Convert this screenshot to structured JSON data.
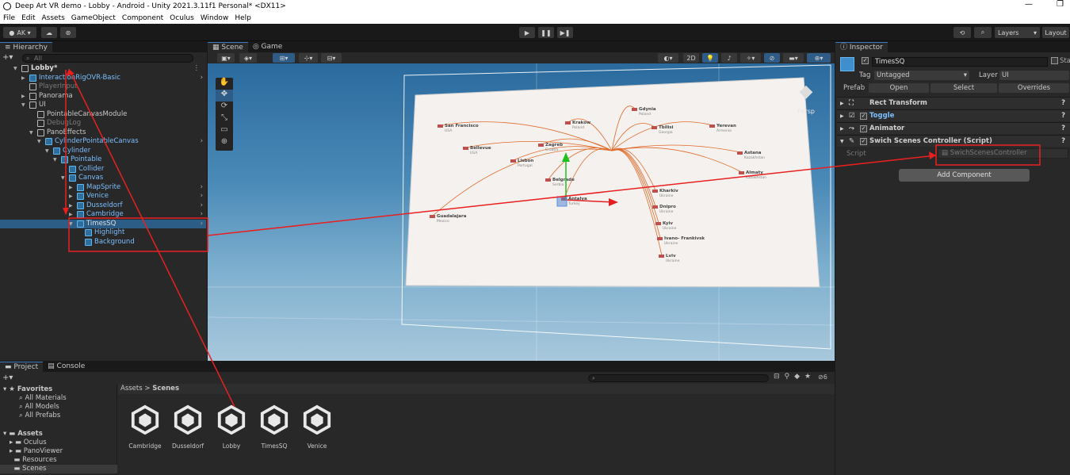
{
  "window": {
    "title": "Deep Art VR demo - Lobby - Android - Unity 2021.3.11f1 Personal* <DX11>",
    "minimize": "—",
    "restore": "❐"
  },
  "menu": [
    "File",
    "Edit",
    "Assets",
    "GameObject",
    "Component",
    "Oculus",
    "Window",
    "Help"
  ],
  "toolbar": {
    "account": "AK ▾",
    "layers": "Layers",
    "layout": "Layout"
  },
  "hierarchy": {
    "tab": "Hierarchy",
    "search_placeholder": "All",
    "rows": [
      {
        "label": "Lobby*",
        "depth": 0,
        "style": "white"
      },
      {
        "label": "InteractionRigOVR-Basic",
        "depth": 1,
        "style": "blue"
      },
      {
        "label": "PlayerInput",
        "depth": 1,
        "style": "dim"
      },
      {
        "label": "Panorama",
        "depth": 1,
        "style": "normal"
      },
      {
        "label": "UI",
        "depth": 1,
        "style": "normal"
      },
      {
        "label": "PointableCanvasModule",
        "depth": 2,
        "style": "normal"
      },
      {
        "label": "DebugLog",
        "depth": 2,
        "style": "dim"
      },
      {
        "label": "PanoEffects",
        "depth": 2,
        "style": "normal"
      },
      {
        "label": "CylinderPointableCanvas",
        "depth": 3,
        "style": "blue"
      },
      {
        "label": "Cylinder",
        "depth": 4,
        "style": "blue"
      },
      {
        "label": "Pointable",
        "depth": 5,
        "style": "blue"
      },
      {
        "label": "Collider",
        "depth": 6,
        "style": "blue"
      },
      {
        "label": "Canvas",
        "depth": 6,
        "style": "blue"
      },
      {
        "label": "MapSprite",
        "depth": 7,
        "style": "blue"
      },
      {
        "label": "Venice",
        "depth": 7,
        "style": "blue"
      },
      {
        "label": "Dusseldorf",
        "depth": 7,
        "style": "blue"
      },
      {
        "label": "Cambridge",
        "depth": 7,
        "style": "blue"
      },
      {
        "label": "TimesSQ",
        "depth": 7,
        "style": "white",
        "selected": true
      },
      {
        "label": "Highlight",
        "depth": 8,
        "style": "blue"
      },
      {
        "label": "Background",
        "depth": 8,
        "style": "blue"
      }
    ]
  },
  "scene": {
    "tab_scene": "Scene",
    "tab_game": "Game",
    "mode_2d": "2D",
    "persp": "Persp"
  },
  "map_labels": [
    {
      "city": "San Francisco",
      "country": "USA"
    },
    {
      "city": "Bellevue",
      "country": "USA"
    },
    {
      "city": "Lisbon",
      "country": "Portugal"
    },
    {
      "city": "Krakow",
      "country": "Poland"
    },
    {
      "city": "Gdynia",
      "country": "Poland"
    },
    {
      "city": "Zagreb",
      "country": "Croatia"
    },
    {
      "city": "Tbilisi",
      "country": "Georgia"
    },
    {
      "city": "Yerevan",
      "country": "Armenia"
    },
    {
      "city": "Astana",
      "country": "Kazakhstan"
    },
    {
      "city": "Almaty",
      "country": "Kazakhstan"
    },
    {
      "city": "Belgrade",
      "country": "Serbia"
    },
    {
      "city": "Antalya",
      "country": "Turkey"
    },
    {
      "city": "Kharkiv",
      "country": "Ukraine"
    },
    {
      "city": "Dnipro",
      "country": "Ukraine"
    },
    {
      "city": "Kyiv",
      "country": "Ukraine"
    },
    {
      "city": "Ivano- Frankivsk",
      "country": "Ukraine"
    },
    {
      "city": "Lviv",
      "country": "Ukraine"
    },
    {
      "city": "Guadalajara",
      "country": "Mexico"
    }
  ],
  "inspector": {
    "tab": "Inspector",
    "object_name": "TimesSQ",
    "static_label": "Sta",
    "tag_label": "Tag",
    "tag_value": "Untagged",
    "layer_label": "Layer",
    "layer_value": "UI",
    "prefab_label": "Prefab",
    "prefab_open": "Open",
    "prefab_select": "Select",
    "prefab_overrides": "Overrides",
    "components": [
      "Rect Transform",
      "Toggle",
      "Animator",
      "Swich Scenes Controller (Script)"
    ],
    "script_label": "Script",
    "script_value": "SwichScenesController",
    "add_component": "Add Component"
  },
  "project": {
    "tab_project": "Project",
    "tab_console": "Console",
    "favorites": "Favorites",
    "favorite_items": [
      "All Materials",
      "All Models",
      "All Prefabs"
    ],
    "assets": "Assets",
    "asset_folders": [
      "Oculus",
      "PanoViewer",
      "Resources",
      "Scenes"
    ],
    "breadcrumb_root": "Assets",
    "breadcrumb_sep": ">",
    "breadcrumb_current": "Scenes",
    "scenes": [
      "Cambridge",
      "Dusseldorf",
      "Lobby",
      "TimesSQ",
      "Venice"
    ],
    "hidden_count": "6"
  },
  "colors": {
    "accent": "#3a79bb",
    "selection": "#2c5d87",
    "annotation": "#e82020"
  }
}
